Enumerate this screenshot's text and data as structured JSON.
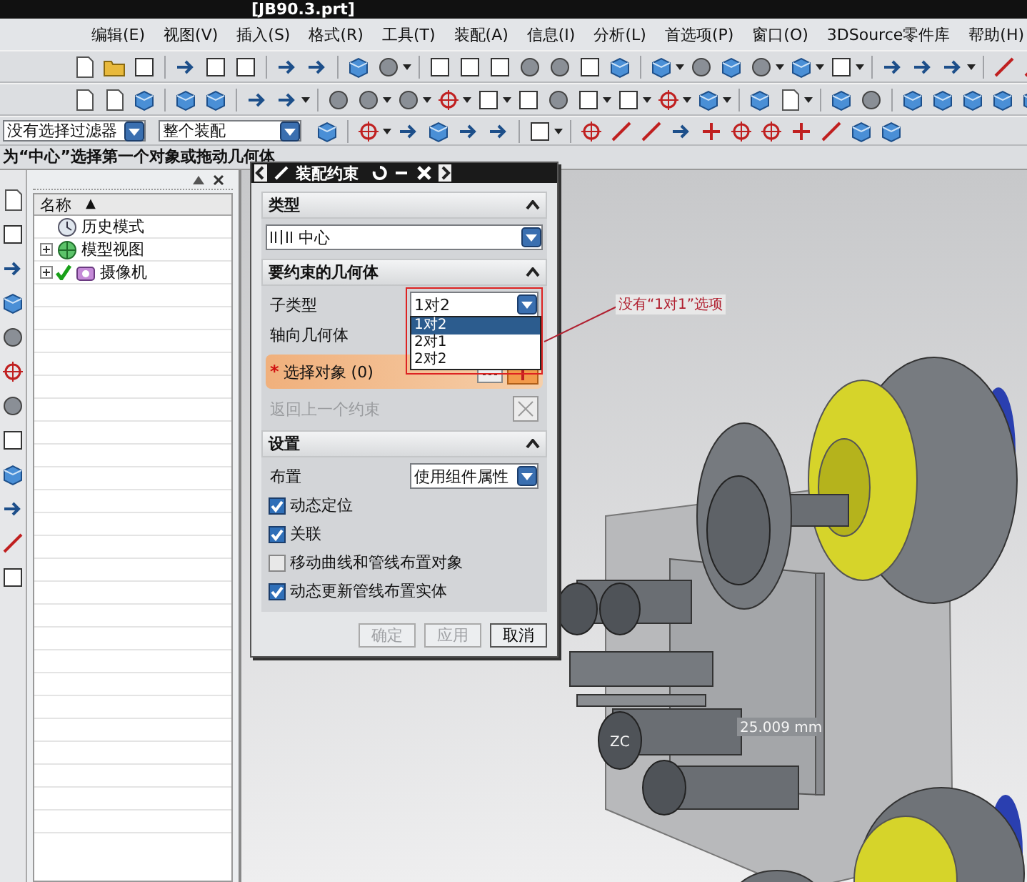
{
  "window": {
    "title": "[JB90.3.prt]"
  },
  "menu": [
    "编辑(E)",
    "视图(V)",
    "插入(S)",
    "格式(R)",
    "工具(T)",
    "装配(A)",
    "信息(I)",
    "分析(L)",
    "首选项(P)",
    "窗口(O)",
    "3DSource零件库",
    "帮助(H)"
  ],
  "selection_bar": {
    "filter": "没有选择过滤器",
    "scope": "整个装配"
  },
  "status_line": "为“中心”选择第一个对象或拖动几何体",
  "navigator": {
    "column": "名称",
    "sort": "▲",
    "nodes": [
      {
        "label": "历史模式",
        "kind": "history",
        "expandable": false,
        "checked": false
      },
      {
        "label": "模型视图",
        "kind": "views",
        "expandable": true,
        "checked": false
      },
      {
        "label": "摄像机",
        "kind": "camera",
        "expandable": true,
        "checked": true
      }
    ]
  },
  "dialog": {
    "title": "装配约束",
    "type_section": {
      "title": "类型",
      "expanded": true,
      "value": "中心"
    },
    "geometry_section": {
      "title": "要约束的几何体",
      "expanded": true,
      "subtype_label": "子类型",
      "subtype_value": "1对2",
      "subtype_options": [
        {
          "label": "1对2",
          "selected": true
        },
        {
          "label": "2对1",
          "selected": false
        },
        {
          "label": "2对2",
          "selected": false
        }
      ],
      "axial_label": "轴向几何体",
      "select_marker": "*",
      "select_label": "选择对象 (0)",
      "back_label": "返回上一个约束",
      "back_disabled": true
    },
    "settings_section": {
      "title": "设置",
      "expanded": true,
      "layout_label": "布置",
      "layout_value": "使用组件属性",
      "options": [
        {
          "label": "动态定位",
          "checked": true
        },
        {
          "label": "关联",
          "checked": true
        },
        {
          "label": "移动曲线和管线布置对象",
          "checked": false
        },
        {
          "label": "动态更新管线布置实体",
          "checked": true
        }
      ]
    },
    "buttons": [
      {
        "label": "确定",
        "disabled": true
      },
      {
        "label": "应用",
        "disabled": true
      },
      {
        "label": "取消",
        "disabled": false
      }
    ]
  },
  "annotation": {
    "text": "没有“1对1”选项"
  },
  "viewport": {
    "dimension": "25.009 mm",
    "axis_label": "ZC"
  }
}
